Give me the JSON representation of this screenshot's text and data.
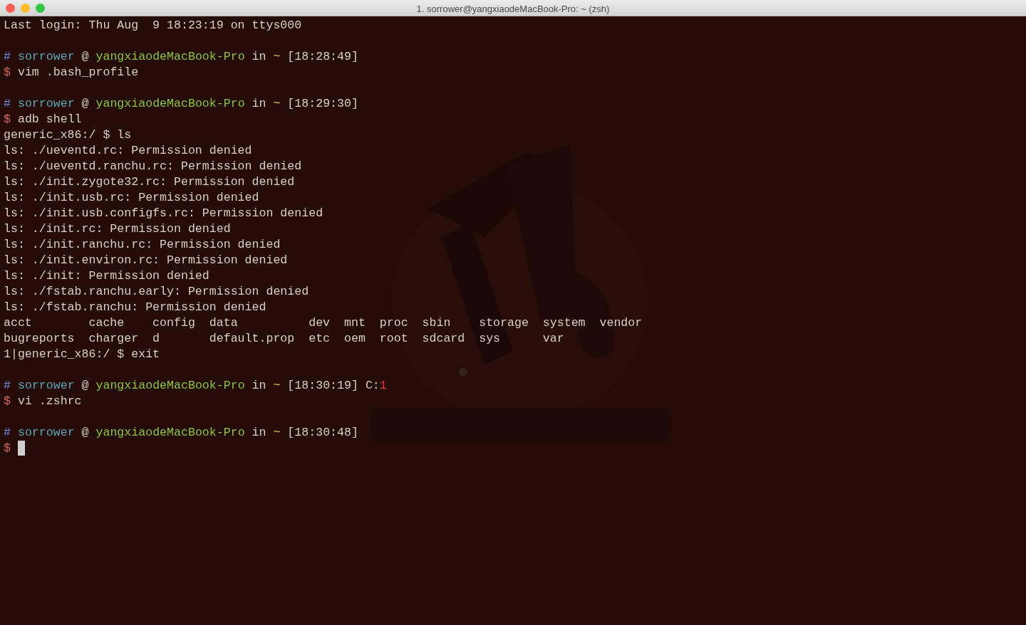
{
  "window": {
    "title": "1. sorrower@yangxiaodeMacBook-Pro: ~ (zsh)"
  },
  "blocks": [
    {
      "lines": [
        {
          "segments": [
            {
              "text": "Last login: Thu Aug  9 18:23:19 on ttys000",
              "kind": "plain"
            }
          ]
        }
      ]
    },
    {
      "lines": [
        {
          "segments": [
            {
              "text": "#",
              "kind": "hash"
            },
            {
              "text": " sorrower",
              "kind": "user"
            },
            {
              "text": " @ ",
              "kind": "plain"
            },
            {
              "text": "yangxiaodeMacBook-Pro",
              "kind": "host"
            },
            {
              "text": " in ",
              "kind": "plain"
            },
            {
              "text": "~",
              "kind": "tilde"
            },
            {
              "text": " [18:28:49]",
              "kind": "plain"
            }
          ]
        },
        {
          "segments": [
            {
              "text": "$",
              "kind": "dollar"
            },
            {
              "text": " vim .bash_profile",
              "kind": "plain"
            }
          ]
        }
      ]
    },
    {
      "lines": [
        {
          "segments": [
            {
              "text": "#",
              "kind": "hash"
            },
            {
              "text": " sorrower",
              "kind": "user"
            },
            {
              "text": " @ ",
              "kind": "plain"
            },
            {
              "text": "yangxiaodeMacBook-Pro",
              "kind": "host"
            },
            {
              "text": " in ",
              "kind": "plain"
            },
            {
              "text": "~",
              "kind": "tilde"
            },
            {
              "text": " [18:29:30]",
              "kind": "plain"
            }
          ]
        },
        {
          "segments": [
            {
              "text": "$",
              "kind": "dollar"
            },
            {
              "text": " adb shell",
              "kind": "plain"
            }
          ]
        },
        {
          "segments": [
            {
              "text": "generic_x86:/ $ ls",
              "kind": "plain"
            }
          ]
        },
        {
          "segments": [
            {
              "text": "ls: ./ueventd.rc: Permission denied",
              "kind": "plain"
            }
          ]
        },
        {
          "segments": [
            {
              "text": "ls: ./ueventd.ranchu.rc: Permission denied",
              "kind": "plain"
            }
          ]
        },
        {
          "segments": [
            {
              "text": "ls: ./init.zygote32.rc: Permission denied",
              "kind": "plain"
            }
          ]
        },
        {
          "segments": [
            {
              "text": "ls: ./init.usb.rc: Permission denied",
              "kind": "plain"
            }
          ]
        },
        {
          "segments": [
            {
              "text": "ls: ./init.usb.configfs.rc: Permission denied",
              "kind": "plain"
            }
          ]
        },
        {
          "segments": [
            {
              "text": "ls: ./init.rc: Permission denied",
              "kind": "plain"
            }
          ]
        },
        {
          "segments": [
            {
              "text": "ls: ./init.ranchu.rc: Permission denied",
              "kind": "plain"
            }
          ]
        },
        {
          "segments": [
            {
              "text": "ls: ./init.environ.rc: Permission denied",
              "kind": "plain"
            }
          ]
        },
        {
          "segments": [
            {
              "text": "ls: ./init: Permission denied",
              "kind": "plain"
            }
          ]
        },
        {
          "segments": [
            {
              "text": "ls: ./fstab.ranchu.early: Permission denied",
              "kind": "plain"
            }
          ]
        },
        {
          "segments": [
            {
              "text": "ls: ./fstab.ranchu: Permission denied",
              "kind": "plain"
            }
          ]
        },
        {
          "segments": [
            {
              "text": "acct        cache    config  data          dev  mnt  proc  sbin    storage  system  vendor",
              "kind": "plain"
            }
          ]
        },
        {
          "segments": [
            {
              "text": "bugreports  charger  d       default.prop  etc  oem  root  sdcard  sys      var",
              "kind": "plain"
            }
          ]
        },
        {
          "segments": [
            {
              "text": "1|generic_x86:/ $ exit",
              "kind": "plain"
            }
          ]
        }
      ]
    },
    {
      "lines": [
        {
          "segments": [
            {
              "text": "#",
              "kind": "hash"
            },
            {
              "text": " sorrower",
              "kind": "user"
            },
            {
              "text": " @ ",
              "kind": "plain"
            },
            {
              "text": "yangxiaodeMacBook-Pro",
              "kind": "host"
            },
            {
              "text": " in ",
              "kind": "plain"
            },
            {
              "text": "~",
              "kind": "tilde"
            },
            {
              "text": " [18:30:19] C:",
              "kind": "plain"
            },
            {
              "text": "1",
              "kind": "error"
            }
          ]
        },
        {
          "segments": [
            {
              "text": "$",
              "kind": "dollar"
            },
            {
              "text": " vi .zshrc",
              "kind": "plain"
            }
          ]
        }
      ]
    },
    {
      "lines": [
        {
          "segments": [
            {
              "text": "#",
              "kind": "hash"
            },
            {
              "text": " sorrower",
              "kind": "user"
            },
            {
              "text": " @ ",
              "kind": "plain"
            },
            {
              "text": "yangxiaodeMacBook-Pro",
              "kind": "host"
            },
            {
              "text": " in ",
              "kind": "plain"
            },
            {
              "text": "~",
              "kind": "tilde"
            },
            {
              "text": " [18:30:48]",
              "kind": "plain"
            }
          ]
        },
        {
          "segments": [
            {
              "text": "$",
              "kind": "dollar"
            }
          ],
          "cursor": true
        }
      ]
    }
  ]
}
